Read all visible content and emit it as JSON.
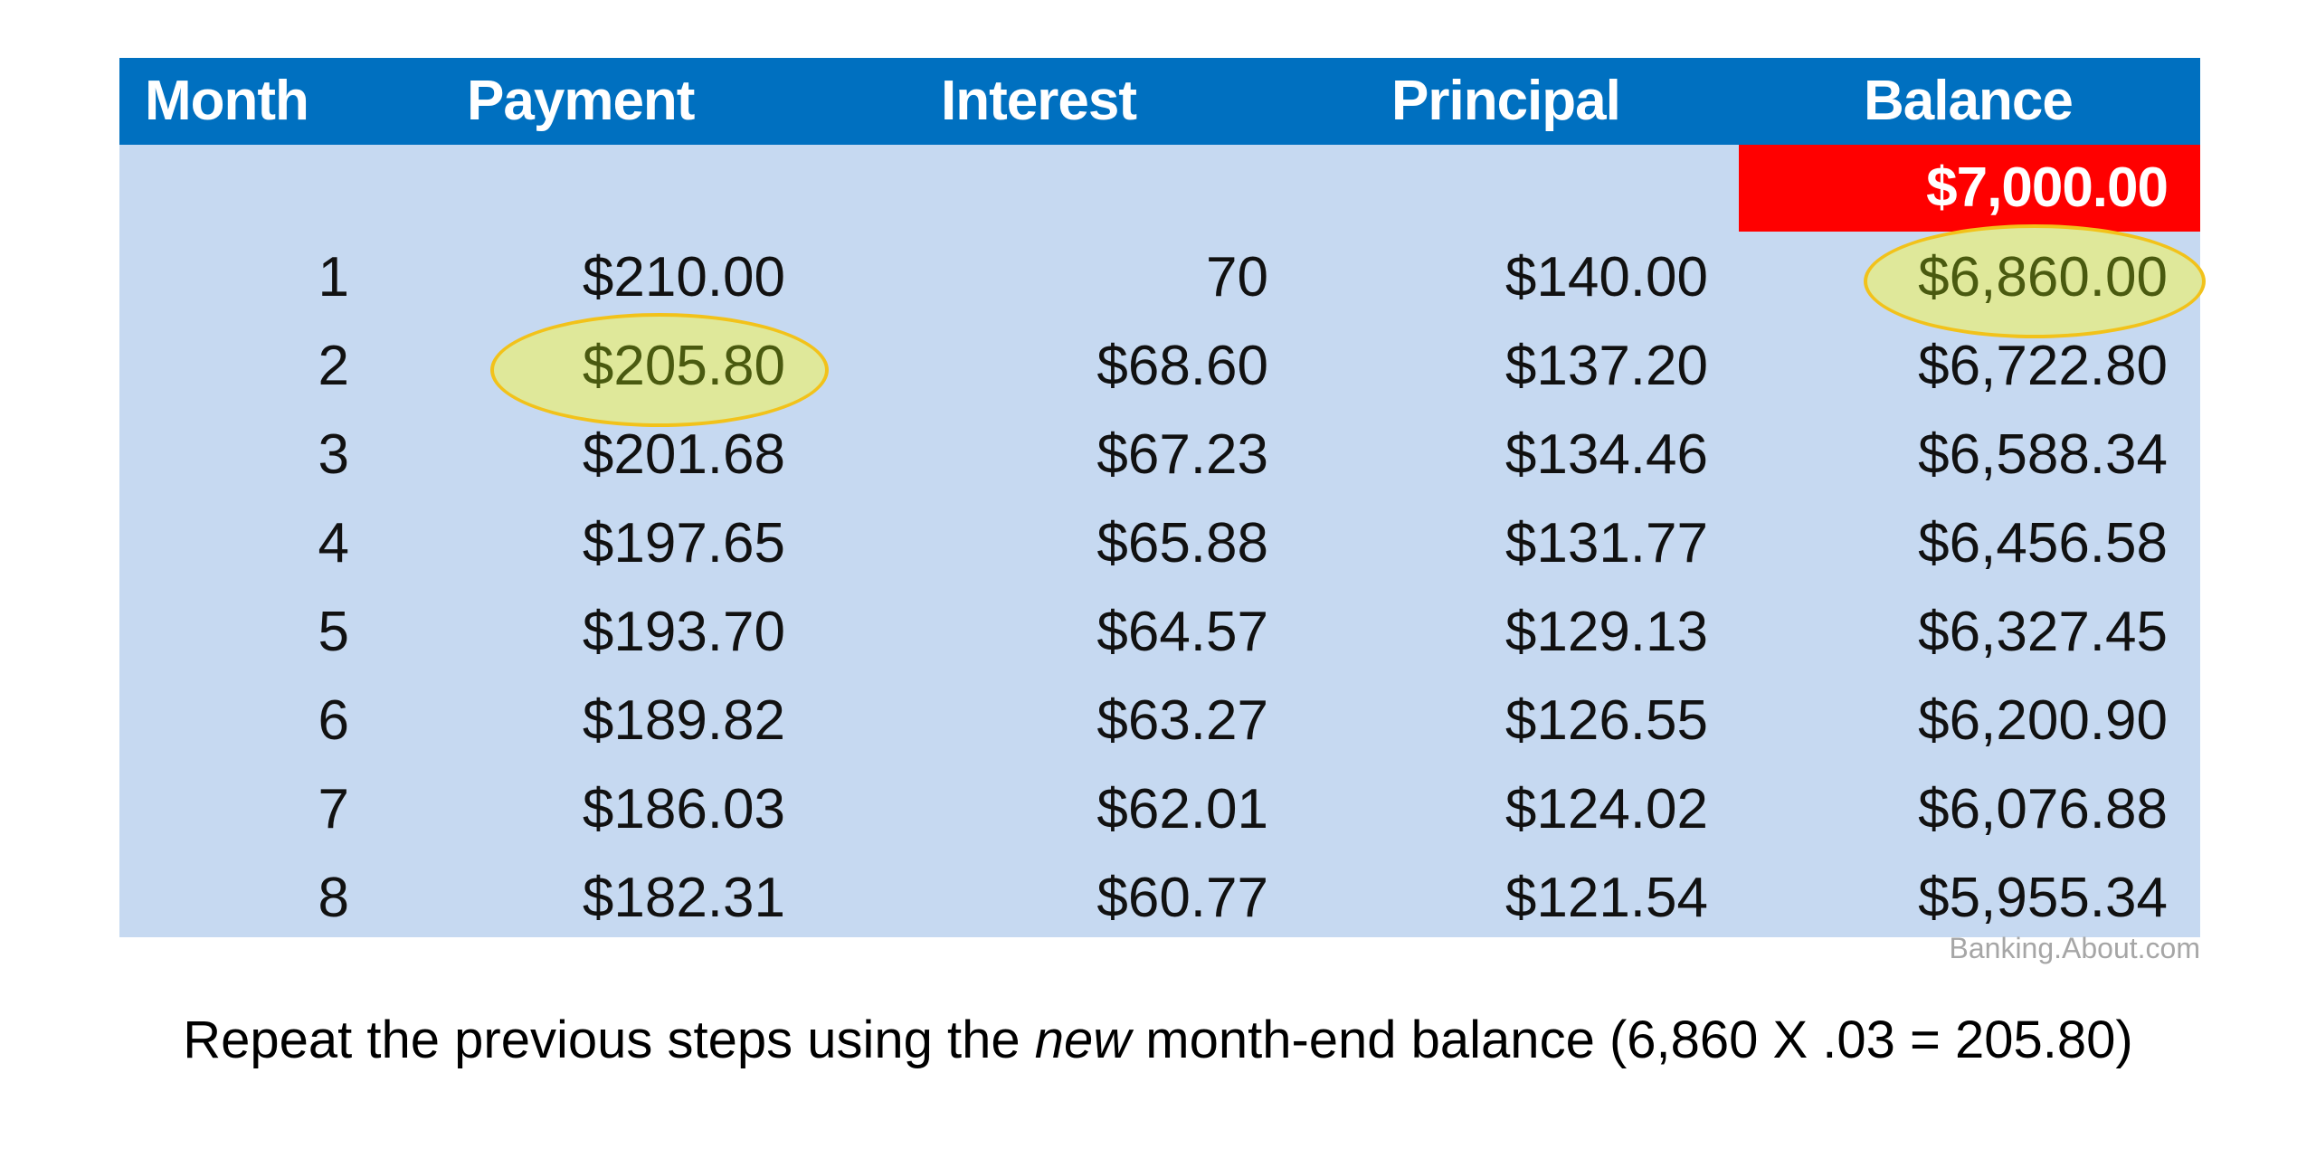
{
  "table": {
    "headers": [
      "Month",
      "Payment",
      "Interest",
      "Principal",
      "Balance"
    ],
    "starting_balance": "$7,000.00",
    "rows": [
      {
        "month": "1",
        "payment": "$210.00",
        "interest": "70",
        "principal": "$140.00",
        "balance": "$6,860.00"
      },
      {
        "month": "2",
        "payment": "$205.80",
        "interest": "$68.60",
        "principal": "$137.20",
        "balance": "$6,722.80"
      },
      {
        "month": "3",
        "payment": "$201.68",
        "interest": "$67.23",
        "principal": "$134.46",
        "balance": "$6,588.34"
      },
      {
        "month": "4",
        "payment": "$197.65",
        "interest": "$65.88",
        "principal": "$131.77",
        "balance": "$6,456.58"
      },
      {
        "month": "5",
        "payment": "$193.70",
        "interest": "$64.57",
        "principal": "$129.13",
        "balance": "$6,327.45"
      },
      {
        "month": "6",
        "payment": "$189.82",
        "interest": "$63.27",
        "principal": "$126.55",
        "balance": "$6,200.90"
      },
      {
        "month": "7",
        "payment": "$186.03",
        "interest": "$62.01",
        "principal": "$124.02",
        "balance": "$6,076.88"
      },
      {
        "month": "8",
        "payment": "$182.31",
        "interest": "$60.77",
        "principal": "$121.54",
        "balance": "$5,955.34"
      }
    ],
    "highlighted": [
      "row 1 balance",
      "row 2 payment"
    ]
  },
  "colors": {
    "header_bg": "#0070c0",
    "body_bg": "#c6d9f1",
    "starting_balance_bg": "#ff0000",
    "highlight_fill": "#dfe89a",
    "highlight_stroke": "#f2c21a"
  },
  "source": "Banking.About.com",
  "caption": {
    "before": "Repeat the previous steps using the ",
    "emphasis": "new",
    "after": " month-end balance (6,860 X .03 = 205.80)"
  }
}
